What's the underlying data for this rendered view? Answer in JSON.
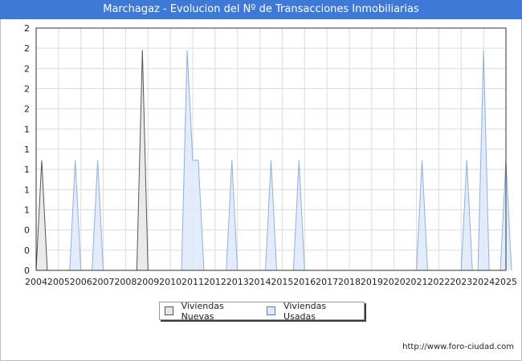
{
  "title": "Marchagaz - Evolucion del Nº de Transacciones Inmobiliarias",
  "source": "http://www.foro-ciudad.com",
  "chart_data": {
    "type": "area",
    "title": "Marchagaz - Evolucion del Nº de Transacciones Inmobiliarias",
    "xlabel": "",
    "ylabel": "",
    "x_ticks": [
      "2004",
      "2005",
      "2006",
      "2007",
      "2008",
      "2009",
      "2010",
      "2011",
      "2012",
      "2013",
      "2014",
      "2015",
      "2016",
      "2017",
      "2018",
      "2019",
      "2020",
      "2021",
      "2022",
      "2023",
      "2024",
      "2025"
    ],
    "y_ticks": [
      "0",
      "0",
      "0",
      "1",
      "1",
      "1",
      "1",
      "1",
      "2",
      "2",
      "2",
      "2"
    ],
    "ylim": [
      0,
      2.2
    ],
    "grid": true,
    "legend_position": "bottom",
    "series": [
      {
        "name": "Viviendas Nuevas",
        "color": "#555555",
        "fill": "#e6e6e6",
        "points": [
          {
            "x": 2004.0,
            "y": 0
          },
          {
            "x": 2004.25,
            "y": 1
          },
          {
            "x": 2004.5,
            "y": 0
          },
          {
            "x": 2008.5,
            "y": 0
          },
          {
            "x": 2008.75,
            "y": 2
          },
          {
            "x": 2009.0,
            "y": 0
          }
        ]
      },
      {
        "name": "Viviendas Usadas",
        "color": "#8fb0e0",
        "fill": "#dde9fa",
        "points": [
          {
            "x": 2005.5,
            "y": 0
          },
          {
            "x": 2005.75,
            "y": 1
          },
          {
            "x": 2006.0,
            "y": 0
          },
          {
            "x": 2006.5,
            "y": 0
          },
          {
            "x": 2006.75,
            "y": 1
          },
          {
            "x": 2007.0,
            "y": 0
          },
          {
            "x": 2010.5,
            "y": 0
          },
          {
            "x": 2010.75,
            "y": 2
          },
          {
            "x": 2011.0,
            "y": 1
          },
          {
            "x": 2011.25,
            "y": 1
          },
          {
            "x": 2011.5,
            "y": 0
          },
          {
            "x": 2012.5,
            "y": 0
          },
          {
            "x": 2012.75,
            "y": 1
          },
          {
            "x": 2013.0,
            "y": 0
          },
          {
            "x": 2014.25,
            "y": 0
          },
          {
            "x": 2014.5,
            "y": 1
          },
          {
            "x": 2014.75,
            "y": 0
          },
          {
            "x": 2015.5,
            "y": 0
          },
          {
            "x": 2015.75,
            "y": 1
          },
          {
            "x": 2016.0,
            "y": 0
          },
          {
            "x": 2021.0,
            "y": 0
          },
          {
            "x": 2021.25,
            "y": 1
          },
          {
            "x": 2021.5,
            "y": 0
          },
          {
            "x": 2023.0,
            "y": 0
          },
          {
            "x": 2023.25,
            "y": 1
          },
          {
            "x": 2023.5,
            "y": 0
          },
          {
            "x": 2023.75,
            "y": 0
          },
          {
            "x": 2024.0,
            "y": 2
          },
          {
            "x": 2024.25,
            "y": 0
          },
          {
            "x": 2024.75,
            "y": 0
          },
          {
            "x": 2025.0,
            "y": 1
          },
          {
            "x": 2025.25,
            "y": 0
          }
        ]
      }
    ]
  }
}
